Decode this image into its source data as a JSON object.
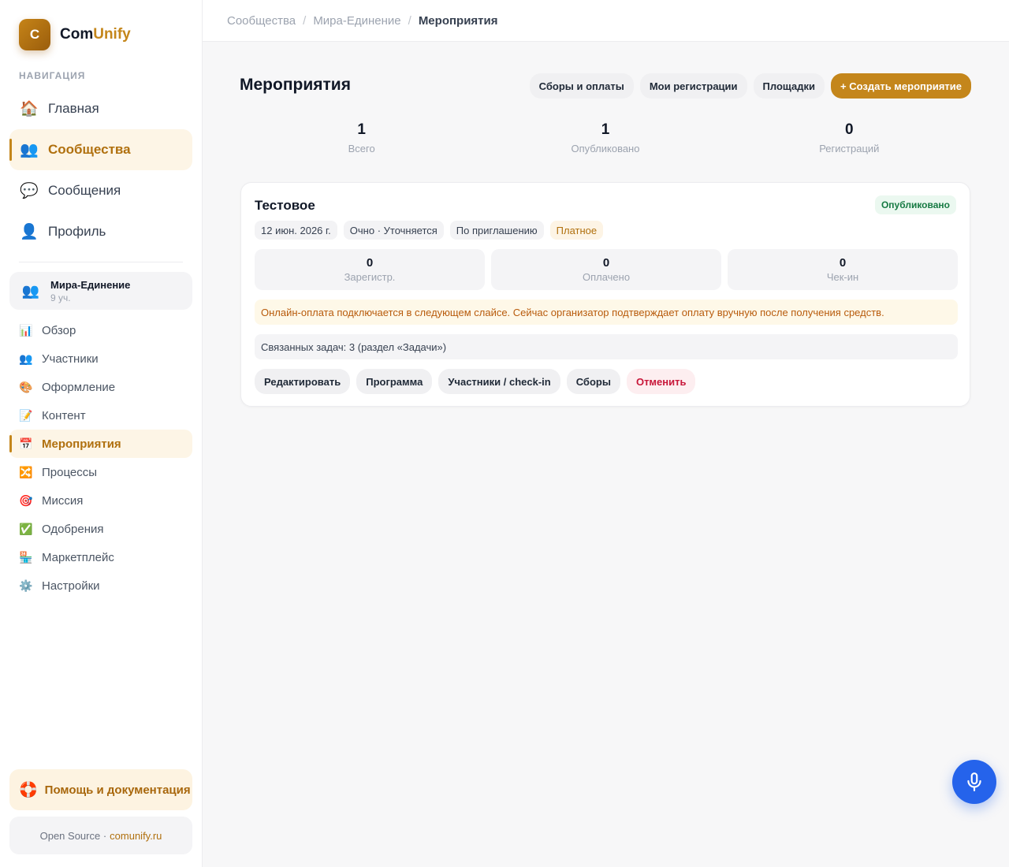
{
  "brand": {
    "logo_letter": "C",
    "name_part1": "Com",
    "name_part2": "Unify",
    "accent_color": "#c4861b"
  },
  "sidebar": {
    "nav_caption": "НАВИГАЦИЯ",
    "main_items": [
      {
        "icon": "home-icon",
        "glyph": "🏠",
        "label": "Главная"
      },
      {
        "icon": "people-icon",
        "glyph": "👥",
        "label": "Сообщества",
        "active": true
      },
      {
        "icon": "chat-icon",
        "glyph": "💬",
        "label": "Сообщения"
      },
      {
        "icon": "user-icon",
        "glyph": "👤",
        "label": "Профиль"
      }
    ],
    "community": {
      "icon": "people-icon",
      "glyph": "👥",
      "name": "Мира-Единение",
      "members": "9 уч."
    },
    "sub_items": [
      {
        "icon": "chart-icon",
        "glyph": "📊",
        "label": "Обзор"
      },
      {
        "icon": "people-icon",
        "glyph": "👥",
        "label": "Участники"
      },
      {
        "icon": "palette-icon",
        "glyph": "🎨",
        "label": "Оформление"
      },
      {
        "icon": "memo-icon",
        "glyph": "📝",
        "label": "Контент"
      },
      {
        "icon": "calendar-icon",
        "glyph": "📅",
        "label": "Мероприятия",
        "active": true
      },
      {
        "icon": "shuffle-icon",
        "glyph": "🔀",
        "label": "Процессы"
      },
      {
        "icon": "target-icon",
        "glyph": "🎯",
        "label": "Миссия"
      },
      {
        "icon": "check-icon",
        "glyph": "✅",
        "label": "Одобрения"
      },
      {
        "icon": "store-icon",
        "glyph": "🏪",
        "label": "Маркетплейс"
      },
      {
        "icon": "gear-icon",
        "glyph": "⚙️",
        "label": "Настройки"
      }
    ],
    "help": {
      "icon": "lifebuoy-icon",
      "glyph": "🛟",
      "label": "Помощь и документация"
    },
    "footer": {
      "text": "Open Source ·",
      "link": "comunify.ru"
    }
  },
  "breadcrumb": [
    "Сообщества",
    "Мира-Единение",
    "Мероприятия"
  ],
  "page": {
    "title": "Мероприятия",
    "actions": {
      "fees": "Сборы и оплаты",
      "my_regs": "Мои регистрации",
      "venues": "Площадки",
      "create": "+ Создать мероприятие"
    },
    "stats": [
      {
        "value": "1",
        "label": "Всего"
      },
      {
        "value": "1",
        "label": "Опубликовано"
      },
      {
        "value": "0",
        "label": "Регистраций"
      }
    ]
  },
  "event": {
    "title": "Тестовое",
    "status": "Опубликовано",
    "tags": {
      "date": "12 июн. 2026 г.",
      "format": "Очно · Уточняется",
      "access": "По приглашению",
      "price": "Платное"
    },
    "mini_stats": [
      {
        "value": "0",
        "label": "Зарегистр."
      },
      {
        "value": "0",
        "label": "Оплачено"
      },
      {
        "value": "0",
        "label": "Чек-ин"
      }
    ],
    "notice": "Онлайн-оплата подключается в следующем слайсе. Сейчас организатор подтверждает оплату вручную после получения средств.",
    "tasks": "Связанных задач: 3 (раздел «Задачи»)",
    "actions": {
      "edit": "Редактировать",
      "program": "Программа",
      "participants": "Участники / check-in",
      "fees": "Сборы",
      "cancel": "Отменить"
    }
  },
  "colors": {
    "primary": "#c4861b",
    "published": "#167a43",
    "danger": "#c8173a",
    "mic": "#2563eb"
  }
}
